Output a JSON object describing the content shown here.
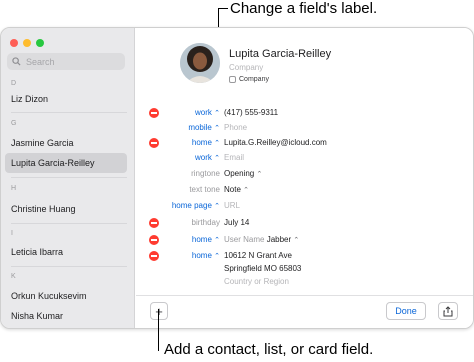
{
  "callouts": {
    "top": "Change a field's label.",
    "bottom": "Add a contact, list, or card field."
  },
  "sidebar": {
    "search_placeholder": "Search",
    "sections": [
      {
        "letter": "D",
        "contacts": [
          "Liz Dizon"
        ]
      },
      {
        "letter": "G",
        "contacts": [
          "Jasmine Garcia",
          "Lupita Garcia-Reilley"
        ]
      },
      {
        "letter": "H",
        "contacts": [
          "Christine Huang"
        ]
      },
      {
        "letter": "I",
        "contacts": [
          "Leticia Ibarra"
        ]
      },
      {
        "letter": "K",
        "contacts": [
          "Orkun Kucuksevim",
          "Nisha Kumar"
        ]
      }
    ],
    "selected": "Lupita Garcia-Reilley"
  },
  "card": {
    "name": "Lupita  Garcia-Reilley",
    "company_placeholder": "Company",
    "company_checkbox_label": "Company",
    "fields": [
      {
        "label": "work",
        "value": "(417) 555-9311",
        "removable": true
      },
      {
        "label": "mobile",
        "value": "Phone",
        "placeholder": true
      },
      {
        "label": "home",
        "value": "Lupita.G.Reilley@icloud.com",
        "removable": true
      },
      {
        "label": "work",
        "value": "Email",
        "placeholder": true
      },
      {
        "label": "ringtone",
        "value": "Opening",
        "gray_label": true
      },
      {
        "label": "text tone",
        "value": "Note",
        "gray_label": true
      },
      {
        "label": "home page",
        "value": "URL",
        "placeholder": true
      },
      {
        "label": "birthday",
        "value": "July 14",
        "removable": true,
        "gray_label": true
      },
      {
        "label": "home",
        "value_prefix": "User Name",
        "value": "Jabber",
        "removable": true
      },
      {
        "label": "home",
        "address": [
          "10612 N Grant Ave",
          "Springfield MO 65803",
          "Country or Region"
        ],
        "removable": true
      }
    ]
  },
  "toolbar": {
    "add_label": "+",
    "done_label": "Done",
    "share_icon": "share-icon"
  },
  "colors": {
    "accent": "#0a66d8",
    "remove": "#ff3b30",
    "sidebar_bg": "#e9e9eb",
    "selected_row": "#d2d2d5"
  }
}
